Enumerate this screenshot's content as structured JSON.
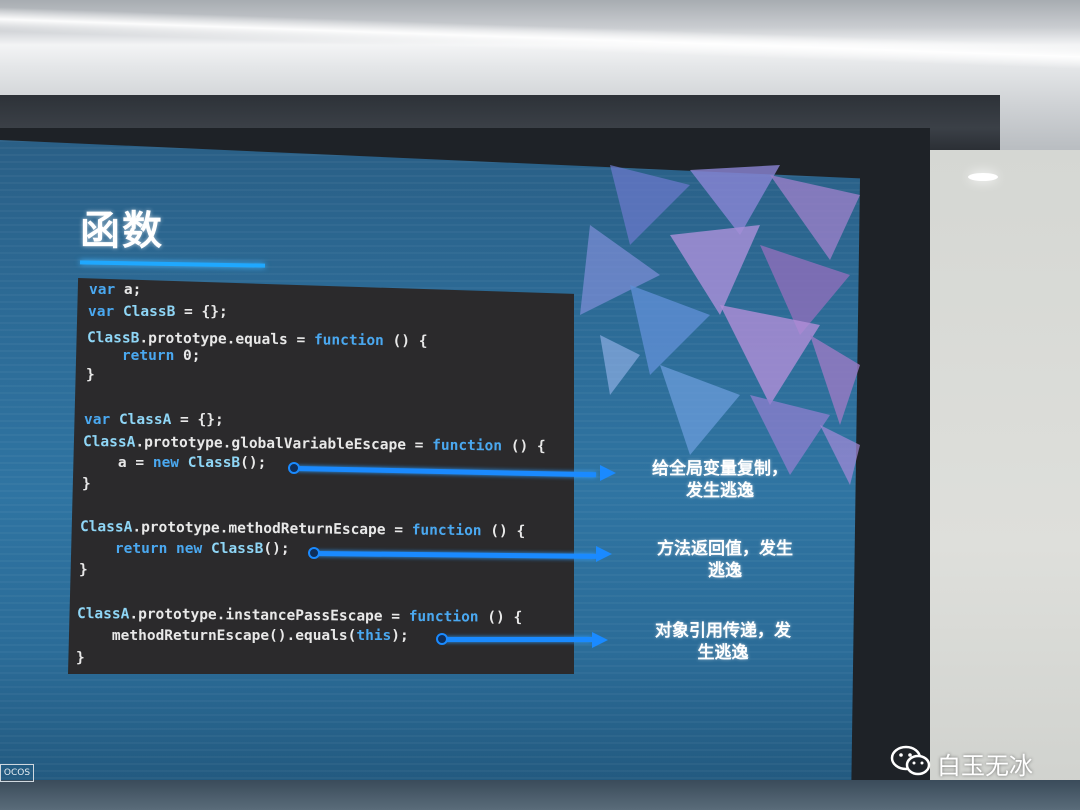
{
  "slide": {
    "title": "函数",
    "code_lines": [
      "var a;",
      "var ClassB = {};",
      "ClassB.prototype.equals = function () {",
      "    return 0;",
      "}",
      "var ClassA = {};",
      "ClassA.prototype.globalVariableEscape = function () {",
      "    a = new ClassB();",
      "}",
      "ClassA.prototype.methodReturnEscape = function () {",
      "    return new ClassB();",
      "}",
      "ClassA.prototype.instancePassEscape = function () {",
      "    methodReturnEscape().equals(this);",
      "}"
    ],
    "annotations": [
      {
        "line1": "给全局变量复制，",
        "line2": "发生逃逸"
      },
      {
        "line1": "方法返回值，发生",
        "line2": "逃逸"
      },
      {
        "line1": "对象引用传递，发",
        "line2": "生逃逸"
      }
    ],
    "corner_logo": "OCOS",
    "colors": {
      "arrow": "#1a8aff",
      "keyword": "#4aa8f0",
      "code_bg": "#2b2a2c",
      "slide_bg": "#2c6a95"
    }
  },
  "watermark": {
    "icon": "wechat-icon",
    "text": "白玉无冰"
  }
}
